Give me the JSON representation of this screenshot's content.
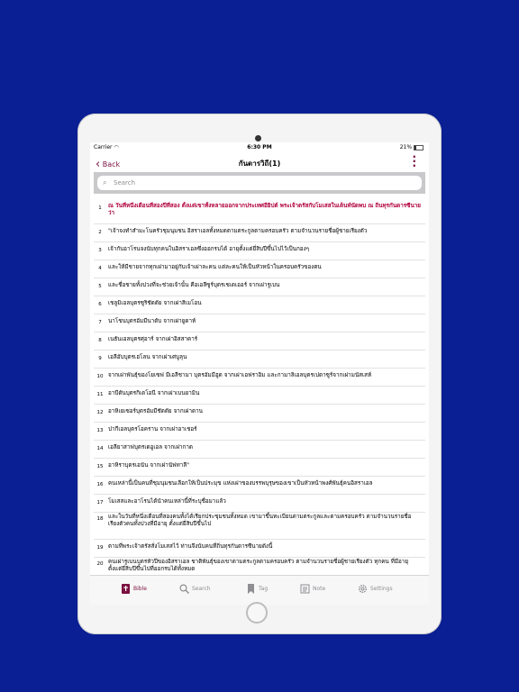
{
  "status": {
    "carrier": "Carrier",
    "time": "6:30 PM",
    "battery": "21%"
  },
  "nav": {
    "back_label": "Back",
    "title": "กันดารวิถี(1)"
  },
  "search": {
    "placeholder": "Search"
  },
  "verses": [
    {
      "num": "1",
      "text": "ณ วันที่หนึ่งเดือนที่สองปีที่สอง ตั้งแต่เขาทั้งหลายออกจากประเทศอียิปต์ พระเจ้าตรัสกับโมเสสในเต็นท์นัดพบ ณ ถิ่นทุรกันดารซีนายว่า",
      "highlight": true
    },
    {
      "num": "2",
      "text": "\"เจ้าจงทำสำมะโนครัวชุมนุมชน อิสราเอลทั้งหมดตามตระกูลตามครอบครัว ตามจำนวนรายชื่อผู้ชายเรียงตัว"
    },
    {
      "num": "3",
      "text": "เจ้ากับอาโรนจงนับทุกคนในอิสราเอลซึ่งออกรบได้ อายุตั้งแต่ยี่สิบปีขึ้นไปไว้เป็นกองๆ"
    },
    {
      "num": "4",
      "text": "และให้มีชายจากทุกเผ่ามาอยู่กับเจ้าเผ่าละคน แต่ละคนให้เป็นหัวหน้าในครอบครัวของตน"
    },
    {
      "num": "5",
      "text": "และชื่อชายทั้งปวงที่จะช่วยเจ้านั้น คือเอลีซูร์บุตรเชเดเออร์ จากเผ่ารูเบน"
    },
    {
      "num": "6",
      "text": "เชลูมิเอลบุตรซูริชัดดัย จากเผ่าสิเมโอน"
    },
    {
      "num": "7",
      "text": "นาโชนบุตรอัมมีนาดับ จากเผ่ายูดาห์"
    },
    {
      "num": "8",
      "text": "เนธันเอลบุตรศุอาร์ จากเผ่าอิสสาคาร์"
    },
    {
      "num": "9",
      "text": "เอลีอับบุตรเฮโลน จากเผ่าเศบูลุน"
    },
    {
      "num": "10",
      "text": "จากเผ่าพันธุ์ของโยเซฟ มีเอลีชามา บุตรอัมมีฮูด จากเผ่าเอฟราอิม และกามาลิเอลบุตรเปดาซูร์จากเผ่ามนัสเสห์"
    },
    {
      "num": "11",
      "text": "อาบีดันบุตรกิเดโอนี จากเผ่าเบนยามิน"
    },
    {
      "num": "12",
      "text": "อาหิเยเซอร์บุตรอัมมีชัดดัย จากเผ่าดาน"
    },
    {
      "num": "13",
      "text": "ปากีเอลบุตรโอคราน จากเผ่าอาเชอร์"
    },
    {
      "num": "14",
      "text": "เอลียาสาฟบุตรเดอูเอล จากเผ่ากาด"
    },
    {
      "num": "15",
      "text": "อาหิราบุตรเอนัน จากเผ่านัฟทาลี\""
    },
    {
      "num": "16",
      "text": "คนเหล่านี้เป็นคนที่ชุมนุมชนเลือกให้เป็นประมุข แห่งเผ่าของบรรพบุรุษของเขาเป็นหัวหน้าพงศ์พันธุ์คนอิสราเอล"
    },
    {
      "num": "17",
      "text": "โมเสสและอาโรนได้นำคนเหล่านี้ที่ระบุชื่อมาแล้ว"
    },
    {
      "num": "18",
      "text": "และในวันที่หนึ่งเดือนที่สองคนทั้งได้เรียกประชุมชนทั้งหมด เขามาขึ้นทะเบียนตามตระกูลและตามครอบครัว ตามจำนวนรายชื่อเรียงตัวคนทั้งปวงที่มีอายุ ตั้งแต่ยี่สิบปีขึ้นไป"
    },
    {
      "num": "19",
      "text": "ตามที่พระเจ้าตรัสสั่งโมเสสไว้ ท่านจึงนับคนที่ถิ่นทุรกันดารซีนายดังนี้"
    },
    {
      "num": "20",
      "text": "คนเผ่ารูเบนบุตรหัวปีของอิสราเอล ชาติพันธุ์ของเขาตามตระกูลตามครอบครัว ตามจำนวนรายชื่อผู้ชายเรียงตัว ทุกคน ที่มีอายุตั้งแต่ยี่สิบปีขึ้นไปที่ออกรบได้ทั้งหมด"
    }
  ],
  "tabs": [
    {
      "label": "Bible",
      "icon": "bible-icon",
      "active": true
    },
    {
      "label": "Search",
      "icon": "search-icon"
    },
    {
      "label": "Tag",
      "icon": "tag-icon"
    },
    {
      "label": "Note",
      "icon": "note-icon"
    },
    {
      "label": "Settings",
      "icon": "gear-icon"
    }
  ],
  "colors": {
    "accent": "#7a1040",
    "highlight": "#b0003a",
    "background": "#0a1f93"
  }
}
